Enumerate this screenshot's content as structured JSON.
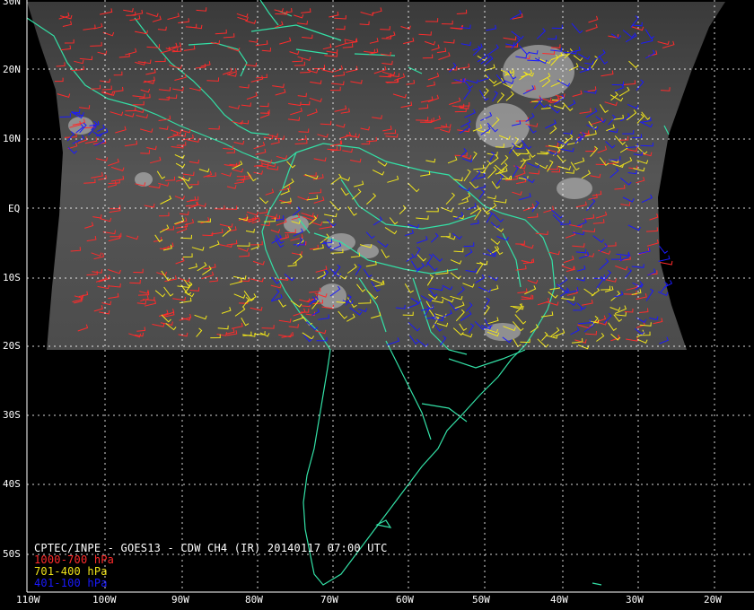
{
  "title": "CPTEC/INPE - GOES13 - CDW CH4 (IR) 20140117 07:00 UTC",
  "legend": [
    {
      "label": "1000-700 hPa",
      "color": "#ff2b2b"
    },
    {
      "label": "701-400 hPa",
      "color": "#f2e61a"
    },
    {
      "label": "401-100 hPa",
      "color": "#1a1aff"
    }
  ],
  "lat_labels": [
    "30N",
    "20N",
    "10N",
    "EQ",
    "10S",
    "20S",
    "30S",
    "40S",
    "50S"
  ],
  "lon_labels": [
    "110W",
    "100W",
    "90W",
    "80W",
    "70W",
    "60W",
    "50W",
    "40W",
    "30W",
    "20W"
  ],
  "colors": {
    "background": "#000000",
    "coastline": "#33e0a6",
    "grid": "#ffffff",
    "imagery": "#4a4a4a"
  }
}
